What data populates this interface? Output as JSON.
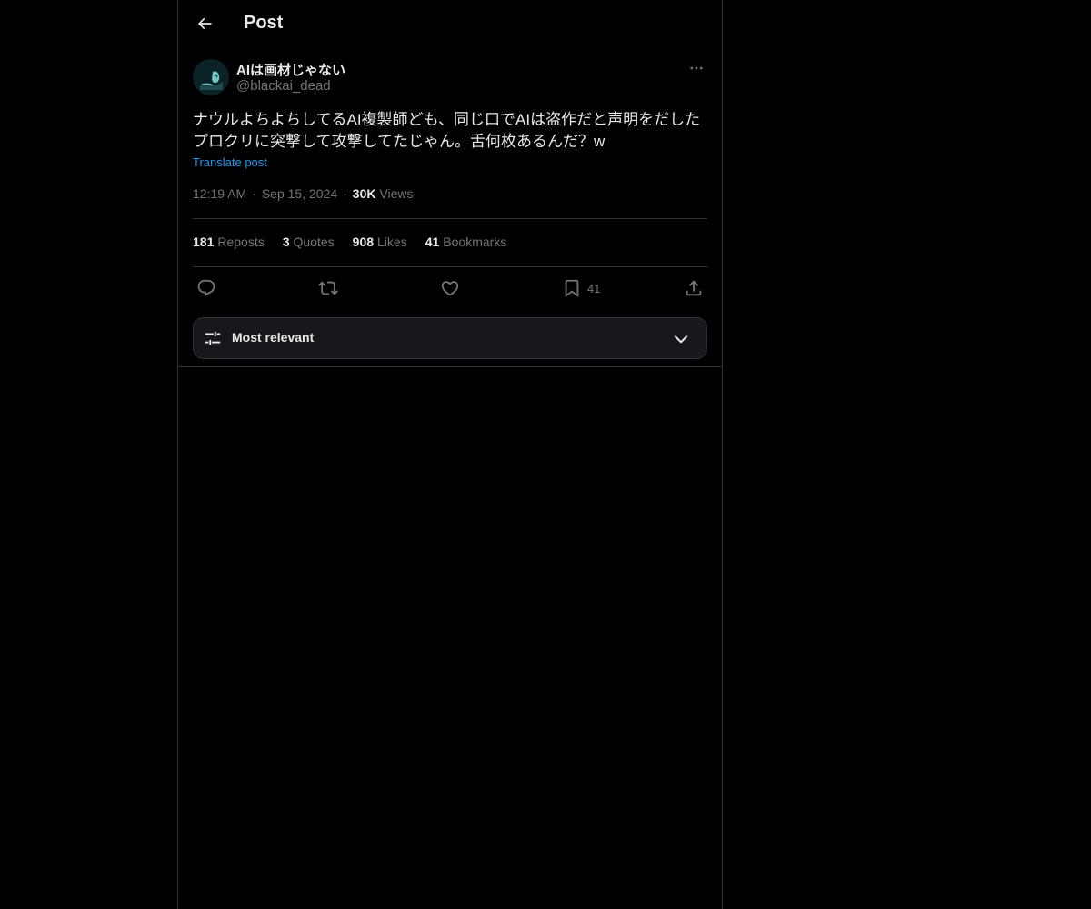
{
  "header": {
    "title": "Post",
    "back_icon": "arrow-left-icon"
  },
  "post": {
    "author": {
      "display_name": "AIは画材じゃない",
      "handle": "@blackai_dead",
      "avatar_icon": "avatar"
    },
    "text": "ナウルよちよちしてるAI複製師ども、同じ口でAIは盗作だと声明をだした\nプロクリに突撃して攻撃してたじゃん。舌何枚あるんだ？w",
    "translate_label": "Translate post",
    "time": "12:19 AM",
    "separator": "·",
    "date": "Sep 15, 2024",
    "views_count": "30K",
    "views_label": "Views"
  },
  "stats": {
    "reposts_count": "181",
    "reposts_label": "Reposts",
    "quotes_count": "3",
    "quotes_label": "Quotes",
    "likes_count": "908",
    "likes_label": "Likes",
    "bookmarks_count": "41",
    "bookmarks_label": "Bookmarks"
  },
  "actions": {
    "reply_icon": "reply-icon",
    "repost_icon": "repost-icon",
    "like_icon": "heart-icon",
    "bookmark_icon": "bookmark-icon",
    "bookmark_count": "41",
    "share_icon": "share-icon"
  },
  "sort": {
    "label": "Most relevant",
    "icon": "sliders-icon",
    "chevron": "chevron-down-icon"
  },
  "colors": {
    "background": "#000000",
    "text_primary": "#e7e9ea",
    "text_secondary": "#71767b",
    "link": "#1d9bf0",
    "border": "#2f3336"
  }
}
